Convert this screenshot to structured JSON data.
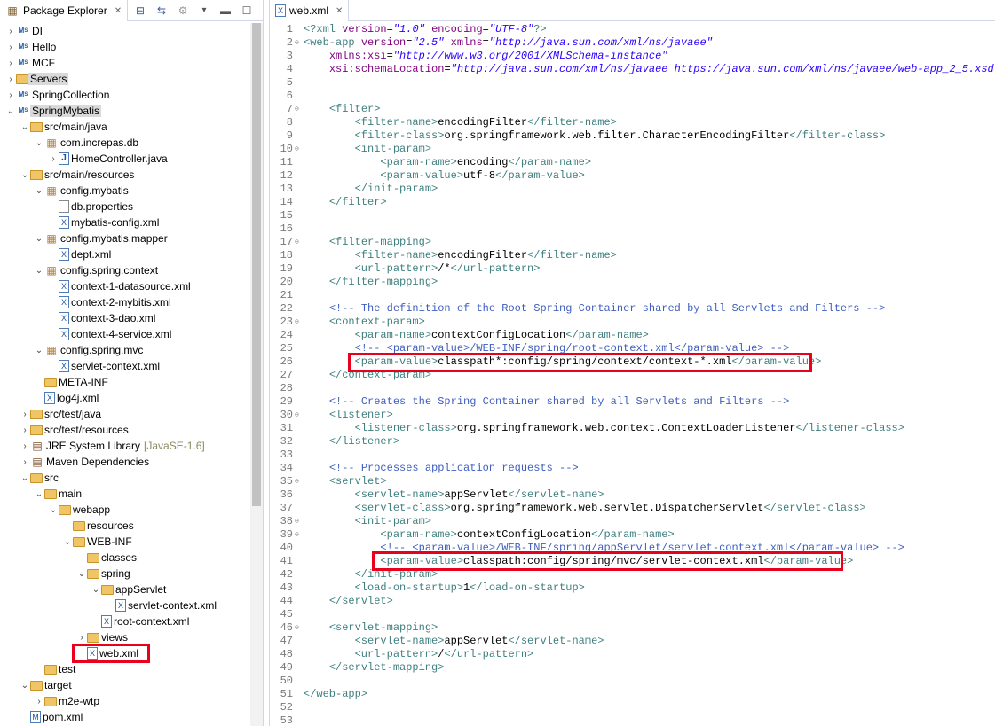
{
  "package_explorer": {
    "title": "Package Explorer",
    "tree": [
      {
        "label": "DI",
        "icon": "maven-project-icon",
        "indent": 0,
        "arrow": "›"
      },
      {
        "label": "Hello",
        "icon": "maven-project-icon",
        "indent": 0,
        "arrow": "›"
      },
      {
        "label": "MCF",
        "icon": "maven-project-icon",
        "indent": 0,
        "arrow": "›"
      },
      {
        "label": "Servers",
        "icon": "folder-icon",
        "indent": 0,
        "arrow": "›",
        "selected": true
      },
      {
        "label": "SpringCollection",
        "icon": "maven-project-icon",
        "indent": 0,
        "arrow": "›"
      },
      {
        "label": "SpringMybatis",
        "icon": "maven-project-icon",
        "indent": 0,
        "arrow": "⌄",
        "selected": true
      },
      {
        "label": "src/main/java",
        "icon": "source-folder-icon",
        "indent": 1,
        "arrow": "⌄"
      },
      {
        "label": "com.increpas.db",
        "icon": "package-icon",
        "indent": 2,
        "arrow": "⌄"
      },
      {
        "label": "HomeController.java",
        "icon": "java-file-icon",
        "indent": 3,
        "arrow": "›"
      },
      {
        "label": "src/main/resources",
        "icon": "source-folder-icon",
        "indent": 1,
        "arrow": "⌄"
      },
      {
        "label": "config.mybatis",
        "icon": "package-icon",
        "indent": 2,
        "arrow": "⌄"
      },
      {
        "label": "db.properties",
        "icon": "file-icon",
        "indent": 3,
        "arrow": ""
      },
      {
        "label": "mybatis-config.xml",
        "icon": "xml-file-icon",
        "indent": 3,
        "arrow": ""
      },
      {
        "label": "config.mybatis.mapper",
        "icon": "package-icon",
        "indent": 2,
        "arrow": "⌄"
      },
      {
        "label": "dept.xml",
        "icon": "xml-file-icon",
        "indent": 3,
        "arrow": ""
      },
      {
        "label": "config.spring.context",
        "icon": "package-icon",
        "indent": 2,
        "arrow": "⌄"
      },
      {
        "label": "context-1-datasource.xml",
        "icon": "xml-file-icon",
        "indent": 3,
        "arrow": ""
      },
      {
        "label": "context-2-mybitis.xml",
        "icon": "xml-file-icon",
        "indent": 3,
        "arrow": ""
      },
      {
        "label": "context-3-dao.xml",
        "icon": "xml-file-icon",
        "indent": 3,
        "arrow": ""
      },
      {
        "label": "context-4-service.xml",
        "icon": "xml-file-icon",
        "indent": 3,
        "arrow": ""
      },
      {
        "label": "config.spring.mvc",
        "icon": "package-icon",
        "indent": 2,
        "arrow": "⌄"
      },
      {
        "label": "servlet-context.xml",
        "icon": "xml-file-icon",
        "indent": 3,
        "arrow": ""
      },
      {
        "label": "META-INF",
        "icon": "folder-icon",
        "indent": 2,
        "arrow": ""
      },
      {
        "label": "log4j.xml",
        "icon": "xml-file-icon",
        "indent": 2,
        "arrow": ""
      },
      {
        "label": "src/test/java",
        "icon": "source-folder-icon",
        "indent": 1,
        "arrow": "›"
      },
      {
        "label": "src/test/resources",
        "icon": "source-folder-icon",
        "indent": 1,
        "arrow": "›"
      },
      {
        "label": "JRE System Library",
        "decoration": "[JavaSE-1.6]",
        "icon": "library-icon",
        "indent": 1,
        "arrow": "›"
      },
      {
        "label": "Maven Dependencies",
        "icon": "library-icon",
        "indent": 1,
        "arrow": "›"
      },
      {
        "label": "src",
        "icon": "folder-icon",
        "indent": 1,
        "arrow": "⌄"
      },
      {
        "label": "main",
        "icon": "folder-icon",
        "indent": 2,
        "arrow": "⌄"
      },
      {
        "label": "webapp",
        "icon": "folder-icon",
        "indent": 3,
        "arrow": "⌄"
      },
      {
        "label": "resources",
        "icon": "folder-icon",
        "indent": 4,
        "arrow": ""
      },
      {
        "label": "WEB-INF",
        "icon": "folder-icon",
        "indent": 4,
        "arrow": "⌄"
      },
      {
        "label": "classes",
        "icon": "folder-icon",
        "indent": 5,
        "arrow": ""
      },
      {
        "label": "spring",
        "icon": "folder-icon",
        "indent": 5,
        "arrow": "⌄"
      },
      {
        "label": "appServlet",
        "icon": "folder-icon",
        "indent": 6,
        "arrow": "⌄"
      },
      {
        "label": "servlet-context.xml",
        "icon": "xml-file-icon",
        "indent": 7,
        "arrow": ""
      },
      {
        "label": "root-context.xml",
        "icon": "xml-file-icon",
        "indent": 6,
        "arrow": ""
      },
      {
        "label": "views",
        "icon": "folder-icon",
        "indent": 5,
        "arrow": "›"
      },
      {
        "label": "web.xml",
        "icon": "xml-file-icon",
        "indent": 5,
        "arrow": "",
        "highlight": true
      },
      {
        "label": "test",
        "icon": "folder-icon",
        "indent": 2,
        "arrow": ""
      },
      {
        "label": "target",
        "icon": "folder-icon",
        "indent": 1,
        "arrow": "⌄"
      },
      {
        "label": "m2e-wtp",
        "icon": "folder-icon",
        "indent": 2,
        "arrow": "›"
      },
      {
        "label": "pom.xml",
        "icon": "maven-pom-icon",
        "indent": 1,
        "arrow": ""
      }
    ]
  },
  "editor": {
    "tab_title": "web.xml",
    "lines": [
      {
        "n": "1",
        "h": "<span class=\"tg\">&lt;?</span><span class=\"tg\">xml</span> <span class=\"an\">version</span>=<span class=\"av\">\"1.0\"</span> <span class=\"an\">encoding</span>=<span class=\"av\">\"UTF-8\"</span><span class=\"tg\">?&gt;</span>"
      },
      {
        "n": "2",
        "fold": true,
        "h": "<span class=\"tg\">&lt;web-app</span> <span class=\"an\">version</span>=<span class=\"av\">\"2.5\"</span> <span class=\"an\">xmlns</span>=<span class=\"av\">\"http://java.sun.com/xml/ns/javaee\"</span>"
      },
      {
        "n": "3",
        "h": "    <span class=\"an\">xmlns:xsi</span>=<span class=\"av\">\"http://www.w3.org/2001/XMLSchema-instance\"</span>"
      },
      {
        "n": "4",
        "h": "    <span class=\"an\">xsi:schemaLocation</span>=<span class=\"av\">\"http://java.sun.com/xml/ns/javaee https://java.sun.com/xml/ns/javaee/web-app_2_5.xsd\"</span><span class=\"tg\">&gt;</span>"
      },
      {
        "n": "5",
        "h": ""
      },
      {
        "n": "6",
        "h": ""
      },
      {
        "n": "7",
        "fold": true,
        "h": "    <span class=\"tg\">&lt;filter&gt;</span>"
      },
      {
        "n": "8",
        "h": "        <span class=\"tg\">&lt;filter-name&gt;</span>encodingFilter<span class=\"tg\">&lt;/filter-name&gt;</span>"
      },
      {
        "n": "9",
        "h": "        <span class=\"tg\">&lt;filter-class&gt;</span>org.springframework.web.filter.CharacterEncodingFilter<span class=\"tg\">&lt;/filter-class&gt;</span>"
      },
      {
        "n": "10",
        "fold": true,
        "h": "        <span class=\"tg\">&lt;init-param&gt;</span>"
      },
      {
        "n": "11",
        "h": "            <span class=\"tg\">&lt;param-name&gt;</span>encoding<span class=\"tg\">&lt;/param-name&gt;</span>"
      },
      {
        "n": "12",
        "h": "            <span class=\"tg\">&lt;param-value&gt;</span>utf-8<span class=\"tg\">&lt;/param-value&gt;</span>"
      },
      {
        "n": "13",
        "h": "        <span class=\"tg\">&lt;/init-param&gt;</span>"
      },
      {
        "n": "14",
        "h": "    <span class=\"tg\">&lt;/filter&gt;</span>"
      },
      {
        "n": "15",
        "h": ""
      },
      {
        "n": "16",
        "h": ""
      },
      {
        "n": "17",
        "fold": true,
        "h": "    <span class=\"tg\">&lt;filter-mapping&gt;</span>"
      },
      {
        "n": "18",
        "h": "        <span class=\"tg\">&lt;filter-name&gt;</span>encodingFilter<span class=\"tg\">&lt;/filter-name&gt;</span>"
      },
      {
        "n": "19",
        "h": "        <span class=\"tg\">&lt;url-pattern&gt;</span>/*<span class=\"tg\">&lt;/url-pattern&gt;</span>"
      },
      {
        "n": "20",
        "h": "    <span class=\"tg\">&lt;/filter-mapping&gt;</span>"
      },
      {
        "n": "21",
        "h": ""
      },
      {
        "n": "22",
        "h": "    <span class=\"cm\">&lt;!-- The definition of the Root Spring Container shared by all Servlets and Filters --&gt;</span>"
      },
      {
        "n": "23",
        "fold": true,
        "h": "    <span class=\"tg\">&lt;context-param&gt;</span>"
      },
      {
        "n": "24",
        "h": "        <span class=\"tg\">&lt;param-name&gt;</span>contextConfigLocation<span class=\"tg\">&lt;/param-name&gt;</span>"
      },
      {
        "n": "25",
        "h": "        <span class=\"cm\">&lt;!-- &lt;param-value&gt;/WEB-INF/spring/root-context.xml&lt;/param-value&gt; --&gt;</span>"
      },
      {
        "n": "26",
        "h": "        <span class=\"tg\">&lt;param-value&gt;</span>classpath*:config/spring/context/context-*.xml<span class=\"tg\">&lt;/param-value&gt;</span>"
      },
      {
        "n": "27",
        "h": "    <span class=\"tg\">&lt;/context-param&gt;</span>"
      },
      {
        "n": "28",
        "h": ""
      },
      {
        "n": "29",
        "h": "    <span class=\"cm\">&lt;!-- Creates the Spring Container shared by all Servlets and Filters --&gt;</span>"
      },
      {
        "n": "30",
        "fold": true,
        "h": "    <span class=\"tg\">&lt;listener&gt;</span>"
      },
      {
        "n": "31",
        "h": "        <span class=\"tg\">&lt;listener-class&gt;</span>org.springframework.web.context.ContextLoaderListener<span class=\"tg\">&lt;/listener-class&gt;</span>"
      },
      {
        "n": "32",
        "h": "    <span class=\"tg\">&lt;/listener&gt;</span>"
      },
      {
        "n": "33",
        "h": ""
      },
      {
        "n": "34",
        "h": "    <span class=\"cm\">&lt;!-- Processes application requests --&gt;</span>"
      },
      {
        "n": "35",
        "fold": true,
        "h": "    <span class=\"tg\">&lt;servlet&gt;</span>"
      },
      {
        "n": "36",
        "h": "        <span class=\"tg\">&lt;servlet-name&gt;</span>appServlet<span class=\"tg\">&lt;/servlet-name&gt;</span>"
      },
      {
        "n": "37",
        "h": "        <span class=\"tg\">&lt;servlet-class&gt;</span>org.springframework.web.servlet.DispatcherServlet<span class=\"tg\">&lt;/servlet-class&gt;</span>"
      },
      {
        "n": "38",
        "fold": true,
        "h": "        <span class=\"tg\">&lt;init-param&gt;</span>"
      },
      {
        "n": "39",
        "fold": true,
        "h": "            <span class=\"tg\">&lt;param-name&gt;</span>contextConfigLocation<span class=\"tg\">&lt;/param-name&gt;</span>"
      },
      {
        "n": "40",
        "h": "            <span class=\"cm\">&lt;!-- &lt;param-value&gt;/WEB-INF/spring/appServlet/servlet-context.xml&lt;/param-value&gt; --&gt;</span>"
      },
      {
        "n": "41",
        "h": "            <span class=\"tg\">&lt;param-value&gt;</span>classpath:config/spring/mvc/servlet-context.xml<span class=\"tg\">&lt;/param-value&gt;</span>"
      },
      {
        "n": "42",
        "h": "        <span class=\"tg\">&lt;/init-param&gt;</span>"
      },
      {
        "n": "43",
        "h": "        <span class=\"tg\">&lt;load-on-startup&gt;</span>1<span class=\"tg\">&lt;/load-on-startup&gt;</span>"
      },
      {
        "n": "44",
        "h": "    <span class=\"tg\">&lt;/servlet&gt;</span>"
      },
      {
        "n": "45",
        "h": ""
      },
      {
        "n": "46",
        "fold": true,
        "h": "    <span class=\"tg\">&lt;servlet-mapping&gt;</span>"
      },
      {
        "n": "47",
        "h": "        <span class=\"tg\">&lt;servlet-name&gt;</span>appServlet<span class=\"tg\">&lt;/servlet-name&gt;</span>"
      },
      {
        "n": "48",
        "h": "        <span class=\"tg\">&lt;url-pattern&gt;</span>/<span class=\"tg\">&lt;/url-pattern&gt;</span>"
      },
      {
        "n": "49",
        "h": "    <span class=\"tg\">&lt;/servlet-mapping&gt;</span>"
      },
      {
        "n": "50",
        "h": ""
      },
      {
        "n": "51",
        "h": "<span class=\"tg\">&lt;/web-app&gt;</span>"
      },
      {
        "n": "52",
        "h": ""
      },
      {
        "n": "53",
        "h": ""
      }
    ]
  },
  "colors": {
    "highlight_box": "#e8001c",
    "tag": "#3f7f7f",
    "attr_name": "#7f007f",
    "attr_value": "#2a00ff",
    "comment": "#3f5fbf"
  }
}
